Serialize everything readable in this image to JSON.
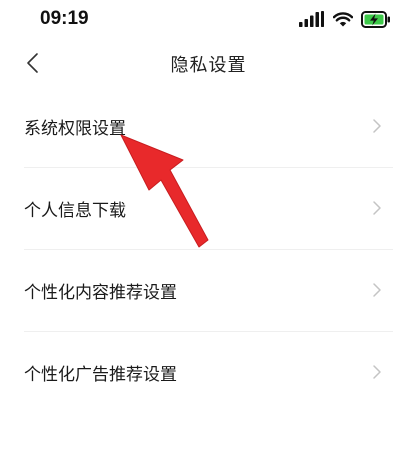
{
  "status_bar": {
    "time": "09:19",
    "icons": [
      "signal-icon",
      "wifi-icon",
      "battery-charging-icon"
    ]
  },
  "nav": {
    "title": "隐私设置",
    "back_icon": "chevron-left-icon"
  },
  "settings": [
    {
      "label": "系统权限设置"
    },
    {
      "label": "个人信息下载"
    },
    {
      "label": "个性化内容推荐设置"
    },
    {
      "label": "个性化广告推荐设置"
    }
  ],
  "annotation": {
    "type": "red-arrow",
    "color": "#e8292b"
  },
  "colors": {
    "accent_red": "#e8292b",
    "battery_green": "#3ec94a",
    "chevron": "#c4c4c4",
    "divider": "#efefef"
  }
}
